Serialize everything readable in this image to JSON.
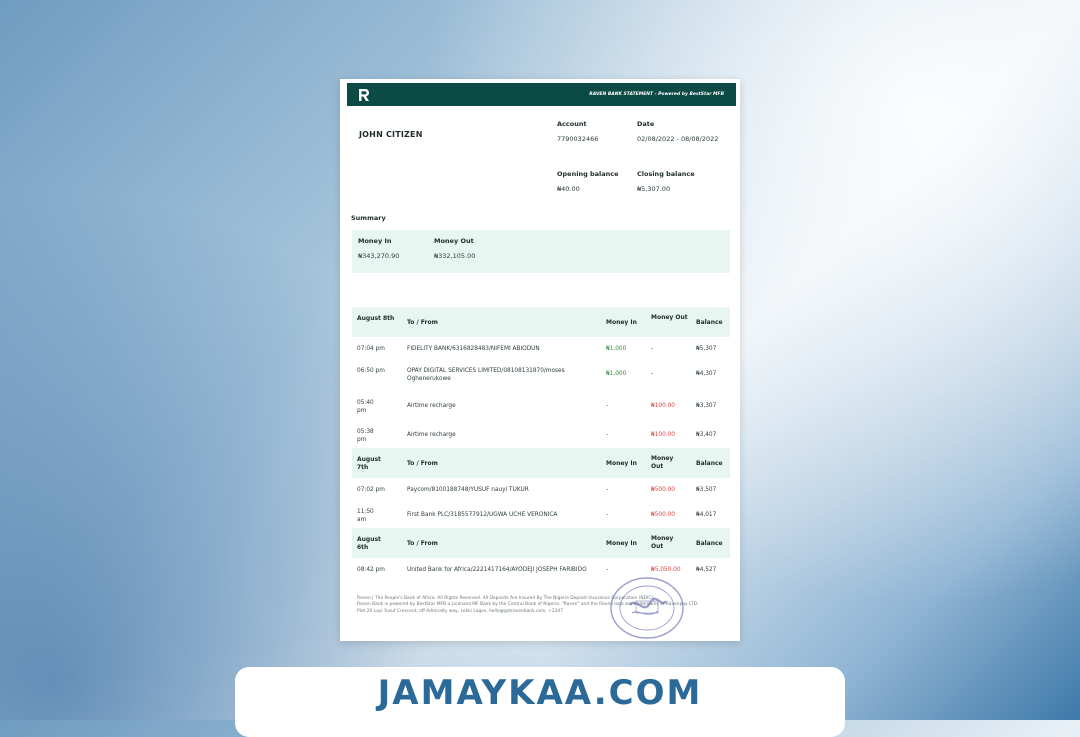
{
  "header": {
    "brand_text": "RAVEN BANK STATEMENT - Powered by BestStar MFB",
    "logo_icon": "raven-logo-icon"
  },
  "customer": {
    "name": "JOHN CITIZEN",
    "account_label": "Account",
    "account_number": "7790032466",
    "date_label": "Date",
    "date_range": "02/08/2022 - 08/08/2022",
    "opening_label": "Opening balance",
    "opening_value": "₦40.00",
    "closing_label": "Closing balance",
    "closing_value": "₦5,307.00"
  },
  "summary": {
    "title": "Summary",
    "money_in_label": "Money In",
    "money_in_value": "₦343,270.90",
    "money_out_label": "Money Out",
    "money_out_value": "₦332,105.00"
  },
  "columns": {
    "to_from": "To / From",
    "money_in": "Money In",
    "money_out": "Money Out",
    "balance": "Balance"
  },
  "groups": [
    {
      "date": "August 8th",
      "rows": [
        {
          "time": "07:04 pm",
          "to_from": "FIDELITY BANK/6316828483/NIFEMI ABIODUN",
          "money_in": "₦1,000",
          "money_out": "-",
          "balance": "₦5,307"
        },
        {
          "time": "06:50 pm",
          "to_from": "OPAY DIGITAL SERVICES LIMITED/08108131870/moses Oghenerukowe",
          "money_in": "₦1,000",
          "money_out": "-",
          "balance": "₦4,307"
        },
        {
          "time": "05:40 pm",
          "to_from": "Airtime recharge",
          "money_in": "-",
          "money_out": "₦100.00",
          "balance": "₦3,307"
        },
        {
          "time": "05:38 pm",
          "to_from": "Airtime recharge",
          "money_in": "-",
          "money_out": "₦100.00",
          "balance": "₦3,407"
        }
      ]
    },
    {
      "date": "August 7th",
      "rows": [
        {
          "time": "07:02 pm",
          "to_from": "Paycom/8100188748/YUSUF nauyi TUKUR",
          "money_in": "-",
          "money_out": "₦500.00",
          "balance": "₦3,507"
        },
        {
          "time": "11:50 am",
          "to_from": "First Bank PLC/3185577912/UGWA UCHE VERONICA",
          "money_in": "-",
          "money_out": "₦500.00",
          "balance": "₦4,017"
        }
      ]
    },
    {
      "date": "August 6th",
      "rows": [
        {
          "time": "08:42 pm",
          "to_from": "United Bank for Africa/2221417164/AYODEJI JOSEPH FARIBIDO",
          "money_in": "-",
          "money_out": "₦5,050.00",
          "balance": "₦4,527"
        }
      ]
    }
  ],
  "footer": {
    "line1": "Raven | The People's Bank of Africa. All Rights Reserved. All Deposits Are Insured By The Nigeria Deposit Insurance Corporation (NDIC).",
    "line2": "Raven Bank is powered by BestStar MFB a Licensed MF Bank by the Central Bank of Nigeria. \"Raven\" and the Raven logo are trademarks of Ravenpay LTD.",
    "line3": "Plot 20 Layi Yusuf Crescent, off Admiralty way, Lekki Lagos, hello@getravenbank.com, +2347"
  },
  "stamp": {
    "icon": "bank-stamp-icon"
  },
  "banner": {
    "text": "JAMAYKAA.COM"
  }
}
